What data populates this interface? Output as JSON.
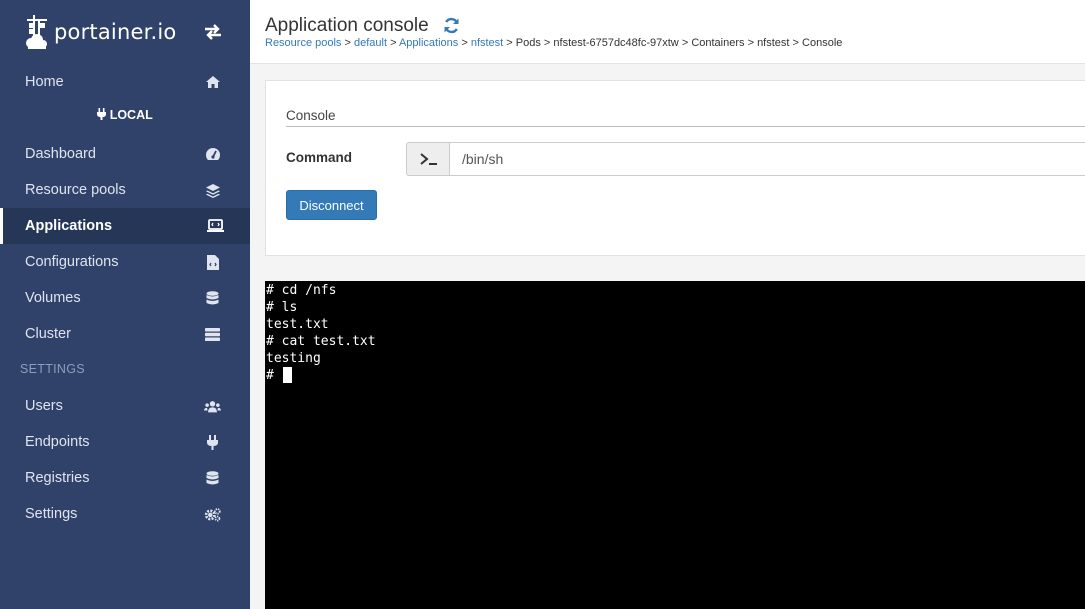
{
  "sidebar": {
    "brand": "portainer.io",
    "home_label": "Home",
    "endpoint": "LOCAL",
    "items": [
      {
        "label": "Dashboard"
      },
      {
        "label": "Resource pools"
      },
      {
        "label": "Applications"
      },
      {
        "label": "Configurations"
      },
      {
        "label": "Volumes"
      },
      {
        "label": "Cluster"
      }
    ],
    "settings_title": "SETTINGS",
    "settings_items": [
      {
        "label": "Users"
      },
      {
        "label": "Endpoints"
      },
      {
        "label": "Registries"
      },
      {
        "label": "Settings"
      }
    ],
    "colors": {
      "background": "#30426a",
      "active": "#263656"
    }
  },
  "header": {
    "title": "Application console",
    "breadcrumb": {
      "resource_pools": "Resource pools",
      "sep": " > ",
      "default": "default",
      "applications": "Applications",
      "nfstest": "nfstest",
      "pods": "Pods",
      "pod_name": "nfstest-6757dc48fc-97xtw",
      "containers": "Containers",
      "container": "nfstest",
      "console": "Console"
    }
  },
  "console_panel": {
    "legend": "Console",
    "command_label": "Command",
    "command_prompt_icon": ">_",
    "command_value": "/bin/sh",
    "disconnect_label": "Disconnect",
    "accent": "#337ab7"
  },
  "terminal": {
    "lines": [
      "# cd /nfs",
      "# ls",
      "test.txt",
      "# cat test.txt",
      "testing",
      "# "
    ]
  }
}
